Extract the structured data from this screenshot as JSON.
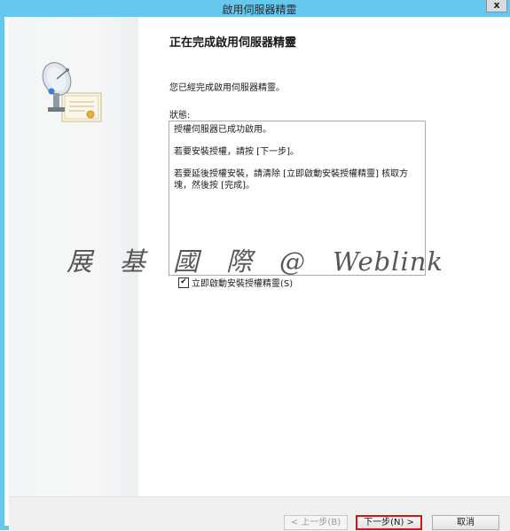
{
  "window": {
    "title": "啟用伺服器精靈",
    "close_glyph": "x"
  },
  "page": {
    "heading": "正在完成啟用伺服器精靈",
    "description": "您已經完成啟用伺服器精靈。",
    "status_label": "狀態:",
    "status_lines": [
      "授權伺服器已成功啟用。",
      "若要安裝授權，請按 [下一步]。",
      "若要延後授權安裝，請清除 [立即啟動安裝授權精靈] 核取方塊，然後按 [完成]。"
    ],
    "checkbox": {
      "label": "立即啟動安裝授權精靈(S)",
      "checked": true,
      "check_glyph": "✔"
    }
  },
  "buttons": {
    "back": "< 上一步(B)",
    "next": "下一步(N) >",
    "cancel": "取消"
  },
  "watermark": "展　基　國　際　@　Weblink",
  "colors": {
    "titlebar": "#66c8ec",
    "highlight_border": "#d3151c"
  },
  "icons": {
    "wizard": "server-certificate-icon"
  }
}
